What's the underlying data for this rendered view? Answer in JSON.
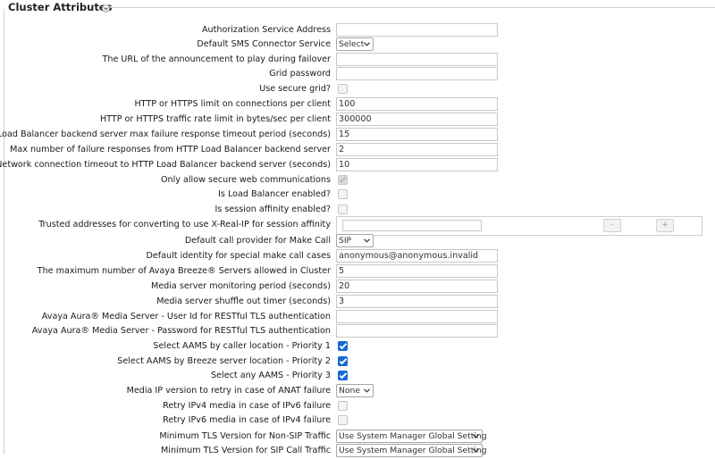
{
  "section": {
    "title": "Cluster Attributes"
  },
  "fields": {
    "auth_service_address": {
      "label": "Authorization Service Address",
      "value": ""
    },
    "default_sms_connector": {
      "label": "Default SMS Connector Service",
      "value": "Select"
    },
    "announcement_url": {
      "label": "The URL of the announcement to play during failover",
      "value": ""
    },
    "grid_password": {
      "label": "Grid password",
      "value": ""
    },
    "use_secure_grid": {
      "label": "Use secure grid?",
      "checked": false
    },
    "http_conn_limit": {
      "label": "HTTP or HTTPS limit on connections per client",
      "value": "100"
    },
    "http_rate_limit": {
      "label": "HTTP or HTTPS traffic rate limit in bytes/sec per client",
      "value": "300000"
    },
    "lb_max_failure_timeout": {
      "label": "HTTP Load Balancer backend server max failure response timeout period (seconds)",
      "value": "15"
    },
    "lb_max_failure_responses": {
      "label": "Max number of failure responses from HTTP Load Balancer backend server",
      "value": "2"
    },
    "lb_network_timeout": {
      "label": "Network connection timeout to HTTP Load Balancer backend server (seconds)",
      "value": "10"
    },
    "only_secure_web": {
      "label": "Only allow secure web communications",
      "checked": true,
      "disabled": true
    },
    "lb_enabled": {
      "label": "Is Load Balancer enabled?",
      "checked": false
    },
    "session_affinity": {
      "label": "Is session affinity enabled?",
      "checked": false
    },
    "trusted_addresses": {
      "label": "Trusted addresses for converting to use X-Real-IP for session affinity",
      "value": "",
      "remove_label": "-",
      "add_label": "+"
    },
    "default_call_provider": {
      "label": "Default call provider for Make Call",
      "value": "SIP"
    },
    "default_identity": {
      "label": "Default identity for special make call cases",
      "value": "anonymous@anonymous.invalid"
    },
    "max_breeze_servers": {
      "label": "The maximum number of Avaya Breeze® Servers allowed in Cluster",
      "value": "5"
    },
    "media_monitoring_period": {
      "label": "Media server monitoring period (seconds)",
      "value": "20"
    },
    "media_shuffle_timer": {
      "label": "Media server shuffle out timer (seconds)",
      "value": "3"
    },
    "aams_user_id": {
      "label": "Avaya Aura® Media Server - User Id for RESTful TLS authentication",
      "value": ""
    },
    "aams_password": {
      "label": "Avaya Aura® Media Server - Password for RESTful TLS authentication",
      "value": ""
    },
    "aams_caller_location": {
      "label": "Select AAMS by caller location - Priority 1",
      "checked": true
    },
    "aams_breeze_location": {
      "label": "Select AAMS by Breeze server location - Priority 2",
      "checked": true
    },
    "aams_any": {
      "label": "Select any AAMS - Priority 3",
      "checked": true
    },
    "media_ip_version": {
      "label": "Media IP version to retry in case of ANAT failure",
      "value": "None"
    },
    "retry_ipv4": {
      "label": "Retry IPv4 media in case of IPv6 failure",
      "checked": false
    },
    "retry_ipv6": {
      "label": "Retry IPv6 media in case of IPv4 failure",
      "checked": false
    },
    "min_tls_non_sip": {
      "label": "Minimum TLS Version for Non-SIP Traffic",
      "value": "Use System Manager Global Setting"
    },
    "min_tls_sip_call": {
      "label": "Minimum TLS Version for SIP Call Traffic",
      "value": "Use System Manager Global Setting"
    }
  },
  "colors": {
    "checkbox_checked": "#1769d6",
    "border": "#c8c8c8"
  }
}
